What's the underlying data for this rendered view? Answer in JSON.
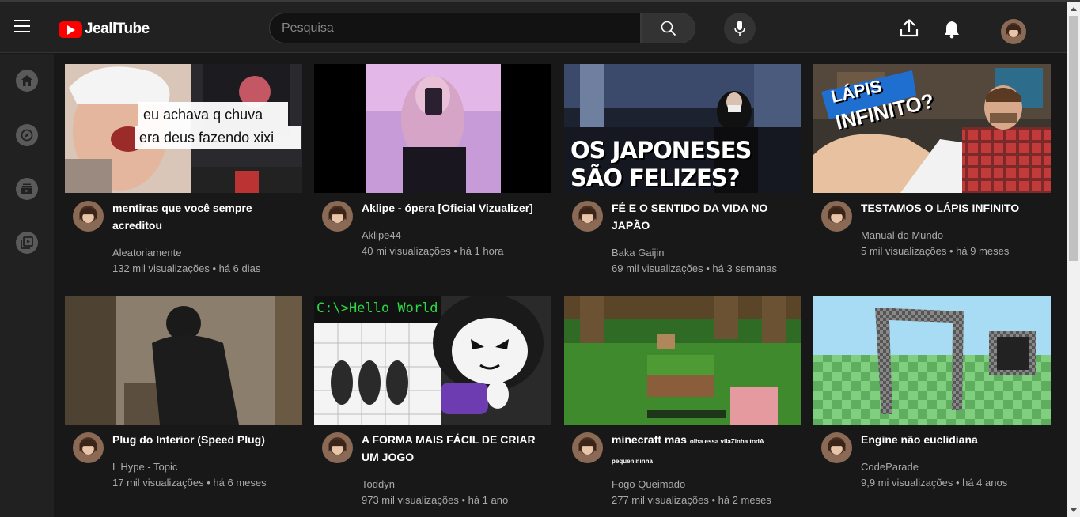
{
  "header": {
    "logo_text": "JeallTube",
    "search_placeholder": "Pesquisa"
  },
  "sidebar": {
    "items": [
      {
        "icon": "home-icon"
      },
      {
        "icon": "explore-icon"
      },
      {
        "icon": "subscriptions-icon"
      },
      {
        "icon": "library-icon"
      }
    ]
  },
  "videos": [
    {
      "title": "mentiras que você sempre acreditou",
      "channel": "Aleatoriamente",
      "meta": "132 mil visualizações • há 6 dias",
      "overlay": [
        "eu achava q chuva",
        "era deus fazendo xixi"
      ]
    },
    {
      "title": "Aklipe - ópera [Oficial Vizualizer]",
      "channel": "Aklipe44",
      "meta": "40 mi visualizações • há 1 hora"
    },
    {
      "title": "FÉ E O SENTIDO DA VIDA NO JAPÃO",
      "channel": "Baka Gaijin",
      "meta": "69 mil visualizações • há 3 semanas",
      "overlay": [
        "OS JAPONESES",
        "SÃO FELIZES?"
      ]
    },
    {
      "title": "TESTAMOS O LÁPIS INFINITO",
      "channel": "Manual do Mundo",
      "meta": "5 mil visualizações • há 9 meses",
      "overlay": [
        "LÁPIS",
        "INFINITO?"
      ]
    },
    {
      "title": "Plug do Interior (Speed Plug)",
      "channel": "L Hype - Topic",
      "meta": "17 mil visualizações • há 6 meses"
    },
    {
      "title": "A FORMA MAIS FÁCIL DE CRIAR UM JOGO",
      "channel": "Toddyn",
      "meta": "973 mil visualizações • há 1 ano",
      "overlay": [
        "C:\\>Hello World"
      ]
    },
    {
      "title": "minecraft mas",
      "title_small": "olha essa vilaZinha todA pequenininha",
      "channel": "Fogo Queimado",
      "meta": "277 mil visualizações • há 2 meses"
    },
    {
      "title": "Engine não euclidiana",
      "channel": "CodeParade",
      "meta": "9,9 mi visualizações • há 4 anos"
    }
  ]
}
